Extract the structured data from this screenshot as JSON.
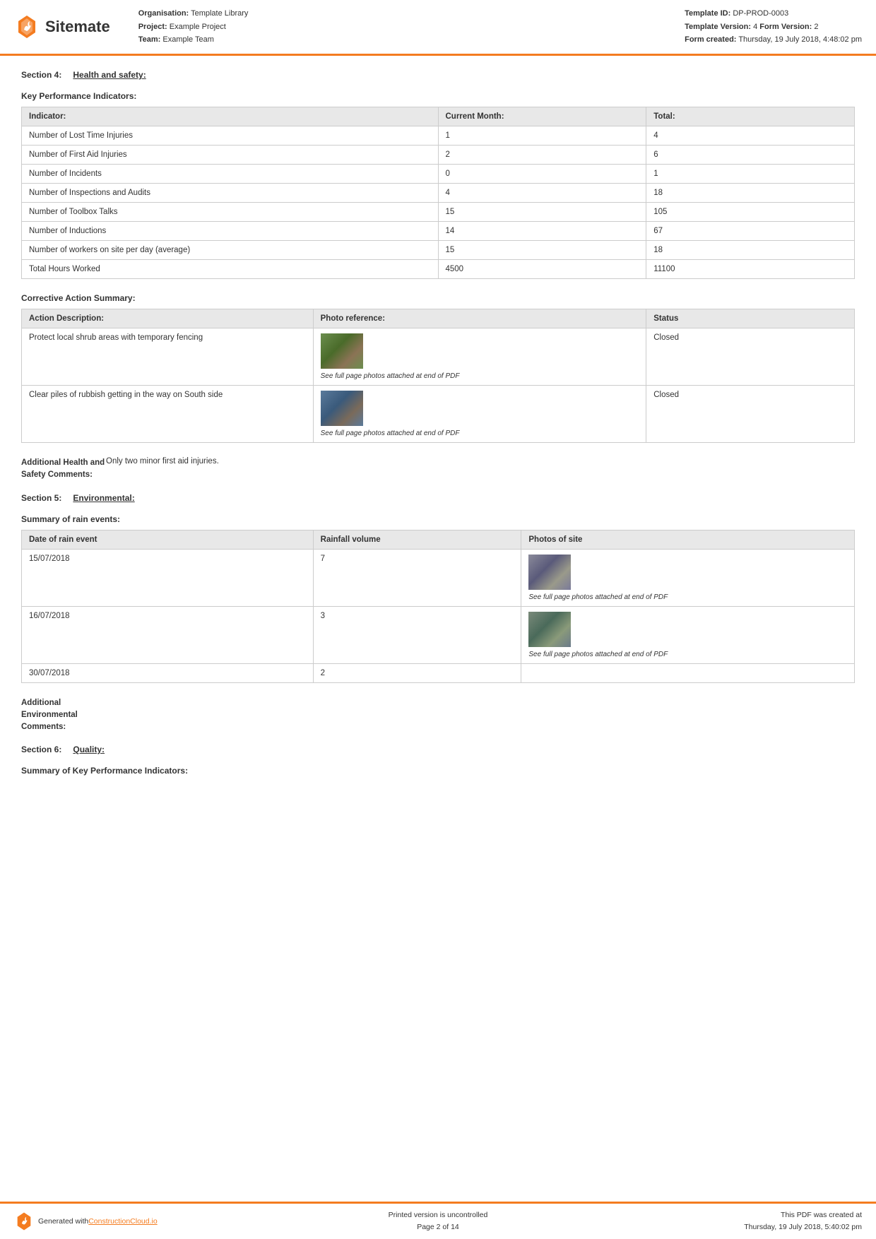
{
  "header": {
    "logo_text": "Sitemate",
    "org_label": "Organisation:",
    "org_value": "Template Library",
    "project_label": "Project:",
    "project_value": "Example Project",
    "team_label": "Team:",
    "team_value": "Example Team",
    "template_id_label": "Template ID:",
    "template_id_value": "DP-PROD-0003",
    "template_version_label": "Template Version:",
    "template_version_value": "4",
    "form_version_label": "Form Version:",
    "form_version_value": "2",
    "form_created_label": "Form created:",
    "form_created_value": "Thursday, 19 July 2018, 4:48:02 pm"
  },
  "section4": {
    "label": "Section 4:",
    "title": "Health and safety:"
  },
  "kpi": {
    "heading": "Key Performance Indicators:",
    "columns": [
      "Indicator:",
      "Current Month:",
      "Total:"
    ],
    "rows": [
      {
        "indicator": "Number of Lost Time Injuries",
        "current_month": "1",
        "total": "4"
      },
      {
        "indicator": "Number of First Aid Injuries",
        "current_month": "2",
        "total": "6"
      },
      {
        "indicator": "Number of Incidents",
        "current_month": "0",
        "total": "1"
      },
      {
        "indicator": "Number of Inspections and Audits",
        "current_month": "4",
        "total": "18"
      },
      {
        "indicator": "Number of Toolbox Talks",
        "current_month": "15",
        "total": "105"
      },
      {
        "indicator": "Number of Inductions",
        "current_month": "14",
        "total": "67"
      },
      {
        "indicator": "Number of workers on site per day (average)",
        "current_month": "15",
        "total": "18"
      },
      {
        "indicator": "Total Hours Worked",
        "current_month": "4500",
        "total": "11100"
      }
    ]
  },
  "corrective_action": {
    "heading": "Corrective Action Summary:",
    "columns": [
      "Action Description:",
      "Photo reference:",
      "Status"
    ],
    "rows": [
      {
        "description": "Protect local shrub areas with temporary fencing",
        "photo_caption": "See full page photos attached at end of PDF",
        "status": "Closed"
      },
      {
        "description": "Clear piles of rubbish getting in the way on South side",
        "photo_caption": "See full page photos attached at end of PDF",
        "status": "Closed"
      }
    ]
  },
  "health_comments": {
    "label": "Additional Health and Safety Comments:",
    "value": "Only two minor first aid injuries."
  },
  "section5": {
    "label": "Section 5:",
    "title": "Environmental:"
  },
  "rain_events": {
    "heading": "Summary of rain events:",
    "columns": [
      "Date of rain event",
      "Rainfall volume",
      "Photos of site"
    ],
    "rows": [
      {
        "date": "15/07/2018",
        "volume": "7",
        "has_photo": true,
        "photo_caption": "See full page photos attached at end of PDF"
      },
      {
        "date": "16/07/2018",
        "volume": "3",
        "has_photo": true,
        "photo_caption": "See full page photos attached at end of PDF"
      },
      {
        "date": "30/07/2018",
        "volume": "2",
        "has_photo": false,
        "photo_caption": ""
      }
    ]
  },
  "env_comments": {
    "label": "Additional Environmental Comments:",
    "value": ""
  },
  "section6": {
    "label": "Section 6:",
    "title": "Quality:"
  },
  "quality_kpi": {
    "heading": "Summary of Key Performance Indicators:"
  },
  "footer": {
    "generated_text": "Generated with ",
    "link_text": "ConstructionCloud.io",
    "uncontrolled_text": "Printed version is uncontrolled",
    "page_text": "Page 2 of 14",
    "pdf_created_text": "This PDF was created at",
    "pdf_created_date": "Thursday, 19 July 2018, 5:40:02 pm"
  }
}
